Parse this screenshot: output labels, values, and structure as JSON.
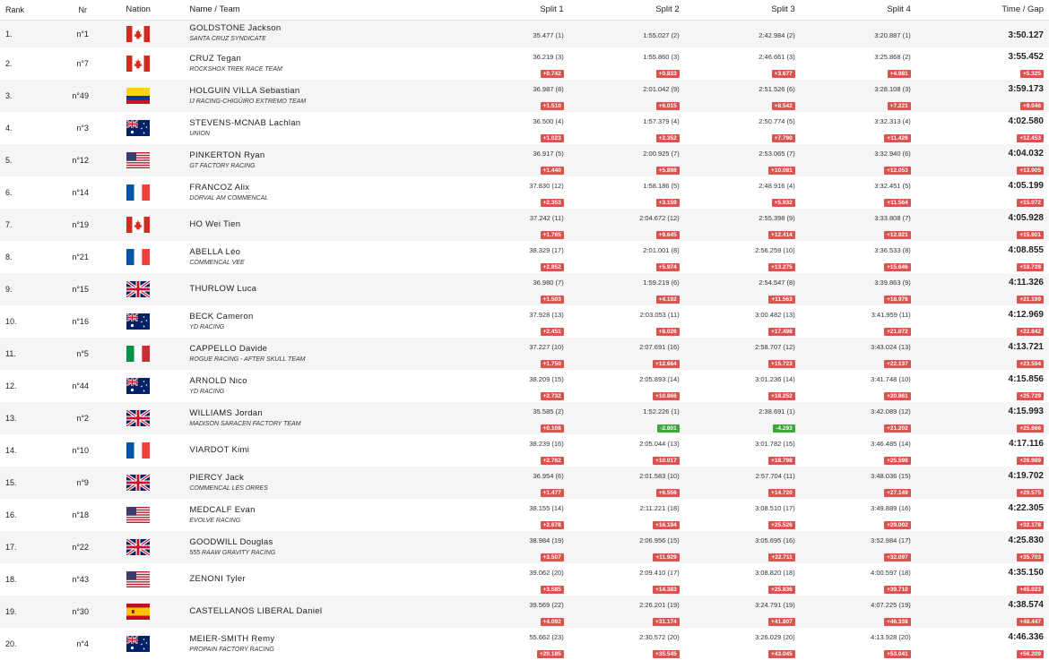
{
  "headers": {
    "rank": "Rank",
    "nr": "Nr",
    "nation": "Nation",
    "name_team": "Name / Team",
    "split1": "Split 1",
    "split2": "Split 2",
    "split3": "Split 3",
    "split4": "Split 4",
    "time_gap": "Time / Gap"
  },
  "rows": [
    {
      "rank": "1.",
      "nr": "n°1",
      "nation": "CAN",
      "name": "GOLDSTONE Jackson",
      "team": "SANTA CRUZ SYNDICATE",
      "s1": "35.477 (1)",
      "g1": "",
      "s2": "1:55.027 (2)",
      "g2": "",
      "s3": "2:42.984 (2)",
      "g3": "",
      "s4": "3:20.887 (1)",
      "g4": "",
      "time": "3:50.127",
      "gap": ""
    },
    {
      "rank": "2.",
      "nr": "n°7",
      "nation": "CAN",
      "name": "CRUZ Tegan",
      "team": "ROCKSHOX TREK RACE TEAM",
      "s1": "36.219 (3)",
      "g1": "+0.742",
      "s2": "1:55.860 (3)",
      "g2": "+0.833",
      "s3": "2:46.661 (3)",
      "g3": "+3.677",
      "s4": "3:25.868 (2)",
      "g4": "+4.981",
      "time": "3:55.452",
      "gap": "+5.325"
    },
    {
      "rank": "3.",
      "nr": "n°49",
      "nation": "COL",
      "name": "HOLGUIN VILLA Sebastian",
      "team": "IJ RACING-CHIGÜIRO EXTREMO TEAM",
      "s1": "36.987 (8)",
      "g1": "+1.510",
      "s2": "2:01.042 (9)",
      "g2": "+6.015",
      "s3": "2:51.526 (6)",
      "g3": "+8.542",
      "s4": "3:28.108 (3)",
      "g4": "+7.221",
      "time": "3:59.173",
      "gap": "+9.046"
    },
    {
      "rank": "4.",
      "nr": "n°3",
      "nation": "AUS",
      "name": "STEVENS-MCNAB Lachlan",
      "team": "UNION",
      "s1": "36.500 (4)",
      "g1": "+1.023",
      "s2": "1:57.379 (4)",
      "g2": "+2.352",
      "s3": "2:50.774 (5)",
      "g3": "+7.790",
      "s4": "3:32.313 (4)",
      "g4": "+11.426",
      "time": "4:02.580",
      "gap": "+12.453"
    },
    {
      "rank": "5.",
      "nr": "n°12",
      "nation": "USA",
      "name": "PINKERTON Ryan",
      "team": "GT FACTORY RACING",
      "s1": "36.917 (5)",
      "g1": "+1.440",
      "s2": "2:00.925 (7)",
      "g2": "+5.898",
      "s3": "2:53.065 (7)",
      "g3": "+10.081",
      "s4": "3:32.940 (6)",
      "g4": "+12.053",
      "time": "4:04.032",
      "gap": "+13.905"
    },
    {
      "rank": "6.",
      "nr": "n°14",
      "nation": "FRA",
      "name": "FRANCOZ Alix",
      "team": "DORVAL AM COMMENCAL",
      "s1": "37.830 (12)",
      "g1": "+2.353",
      "s2": "1:58.186 (5)",
      "g2": "+3.159",
      "s3": "2:48.916 (4)",
      "g3": "+5.932",
      "s4": "3:32.451 (5)",
      "g4": "+11.564",
      "time": "4:05.199",
      "gap": "+15.072"
    },
    {
      "rank": "7.",
      "nr": "n°19",
      "nation": "CAN",
      "name": "HO Wei Tien",
      "team": "",
      "s1": "37.242 (11)",
      "g1": "+1.765",
      "s2": "2:04.672 (12)",
      "g2": "+9.645",
      "s3": "2:55.398 (9)",
      "g3": "+12.414",
      "s4": "3:33.808 (7)",
      "g4": "+12.921",
      "time": "4:05.928",
      "gap": "+15.801"
    },
    {
      "rank": "8.",
      "nr": "n°21",
      "nation": "FRA",
      "name": "ABELLA Léo",
      "team": "COMMENCAL VEE",
      "s1": "38.329 (17)",
      "g1": "+2.852",
      "s2": "2:01.001 (8)",
      "g2": "+5.974",
      "s3": "2:56.259 (10)",
      "g3": "+13.275",
      "s4": "3:36.533 (8)",
      "g4": "+15.646",
      "time": "4:08.855",
      "gap": "+18.728"
    },
    {
      "rank": "9.",
      "nr": "n°15",
      "nation": "GBR",
      "name": "THURLOW Luca",
      "team": "",
      "s1": "36.980 (7)",
      "g1": "+1.503",
      "s2": "1:59.219 (6)",
      "g2": "+4.192",
      "s3": "2:54.547 (8)",
      "g3": "+11.563",
      "s4": "3:39.863 (9)",
      "g4": "+18.976",
      "time": "4:11.326",
      "gap": "+21.199"
    },
    {
      "rank": "10.",
      "nr": "n°16",
      "nation": "AUS",
      "name": "BECK Cameron",
      "team": "YD RACING",
      "s1": "37.928 (13)",
      "g1": "+2.451",
      "s2": "2:03.053 (11)",
      "g2": "+8.026",
      "s3": "3:00.482 (13)",
      "g3": "+17.498",
      "s4": "3:41.959 (11)",
      "g4": "+21.072",
      "time": "4:12.969",
      "gap": "+22.842"
    },
    {
      "rank": "11.",
      "nr": "n°5",
      "nation": "ITA",
      "name": "CAPPELLO Davide",
      "team": "ROGUE RACING - AFTER SKULL TEAM",
      "s1": "37.227 (10)",
      "g1": "+1.750",
      "s2": "2:07.691 (16)",
      "g2": "+12.664",
      "s3": "2:58.707 (12)",
      "g3": "+15.723",
      "s4": "3:43.024 (13)",
      "g4": "+22.137",
      "time": "4:13.721",
      "gap": "+23.594"
    },
    {
      "rank": "12.",
      "nr": "n°44",
      "nation": "AUS",
      "name": "ARNOLD Nico",
      "team": "YD RACING",
      "s1": "38.209 (15)",
      "g1": "+2.732",
      "s2": "2:05.893 (14)",
      "g2": "+10.866",
      "s3": "3:01.236 (14)",
      "g3": "+18.252",
      "s4": "3:41.748 (10)",
      "g4": "+20.861",
      "time": "4:15.856",
      "gap": "+25.729"
    },
    {
      "rank": "13.",
      "nr": "n°2",
      "nation": "GBR",
      "name": "WILLIAMS Jordan",
      "team": "MADISON SARACEN FACTORY TEAM",
      "s1": "35.585 (2)",
      "g1": "+0.108",
      "s2": "1:52.226 (1)",
      "g2": "-2.801",
      "g2green": true,
      "s3": "2:38.691 (1)",
      "g3": "-4.293",
      "g3green": true,
      "s4": "3:42.089 (12)",
      "g4": "+21.202",
      "time": "4:15.993",
      "gap": "+25.866"
    },
    {
      "rank": "14.",
      "nr": "n°10",
      "nation": "FRA",
      "name": "VIARDOT Kimi",
      "team": "",
      "s1": "38.239 (16)",
      "g1": "+2.762",
      "s2": "2:05.044 (13)",
      "g2": "+10.017",
      "s3": "3:01.782 (15)",
      "g3": "+18.798",
      "s4": "3:46.485 (14)",
      "g4": "+25.598",
      "time": "4:17.116",
      "gap": "+26.989"
    },
    {
      "rank": "15.",
      "nr": "n°9",
      "nation": "GBR",
      "name": "PIERCY Jack",
      "team": "COMMENCAL LES ORRES",
      "s1": "36.954 (6)",
      "g1": "+1.477",
      "s2": "2:01.583 (10)",
      "g2": "+6.556",
      "s3": "2:57.704 (11)",
      "g3": "+14.720",
      "s4": "3:48.036 (15)",
      "g4": "+27.149",
      "time": "4:19.702",
      "gap": "+29.575"
    },
    {
      "rank": "16.",
      "nr": "n°18",
      "nation": "USA",
      "name": "MEDCALF Evan",
      "team": "EVOLVE RACING",
      "s1": "38.155 (14)",
      "g1": "+2.678",
      "s2": "2:11.221 (18)",
      "g2": "+16.194",
      "s3": "3:08.510 (17)",
      "g3": "+25.526",
      "s4": "3:49.889 (16)",
      "g4": "+29.002",
      "time": "4:22.305",
      "gap": "+32.178"
    },
    {
      "rank": "17.",
      "nr": "n°22",
      "nation": "GBR",
      "name": "GOODWILL Douglas",
      "team": "555 RAAW GRAVITY RACING",
      "s1": "38.984 (19)",
      "g1": "+3.507",
      "s2": "2:06.956 (15)",
      "g2": "+11.929",
      "s3": "3:05.695 (16)",
      "g3": "+22.711",
      "s4": "3:52.984 (17)",
      "g4": "+32.097",
      "time": "4:25.830",
      "gap": "+35.703"
    },
    {
      "rank": "18.",
      "nr": "n°43",
      "nation": "USA",
      "name": "ZENONI Tyler",
      "team": "",
      "s1": "39.062 (20)",
      "g1": "+3.585",
      "s2": "2:09.410 (17)",
      "g2": "+14.383",
      "s3": "3:08.820 (18)",
      "g3": "+25.836",
      "s4": "4:00.597 (18)",
      "g4": "+39.710",
      "time": "4:35.150",
      "gap": "+45.023"
    },
    {
      "rank": "19.",
      "nr": "n°30",
      "nation": "ESP",
      "name": "CASTELLANOS LIBERAL Daniel",
      "team": "",
      "s1": "39.569 (22)",
      "g1": "+4.092",
      "s2": "2:26.201 (19)",
      "g2": "+31.174",
      "s3": "3:24.791 (19)",
      "g3": "+41.807",
      "s4": "4:07.225 (19)",
      "g4": "+46.338",
      "time": "4:38.574",
      "gap": "+48.447"
    },
    {
      "rank": "20.",
      "nr": "n°4",
      "nation": "AUS",
      "name": "MEIER-SMITH Remy",
      "team": "PROPAIN FACTORY RACING",
      "s1": "55.662 (23)",
      "g1": "+20.185",
      "s2": "2:30.572 (20)",
      "g2": "+35.545",
      "s3": "3:26.029 (20)",
      "g3": "+43.045",
      "s4": "4:13.928 (20)",
      "g4": "+53.041",
      "time": "4:46.336",
      "gap": "+56.209"
    }
  ],
  "colors": {
    "gap_red": "#d9534f",
    "gap_green": "#3fa63a",
    "row_alt": "#f5f5f5"
  }
}
